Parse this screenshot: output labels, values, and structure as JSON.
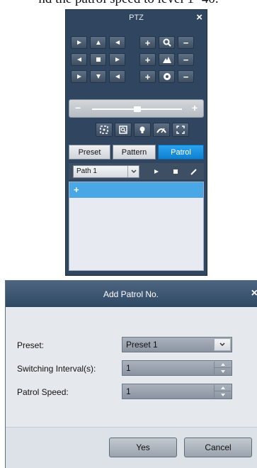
{
  "caption": {
    "cropped_text": "nd the patrol speed to level 1- 40."
  },
  "ptz": {
    "title": "PTZ",
    "close_glyph": "×",
    "direction_grid": [
      "up-left",
      "up",
      "up-right",
      "left",
      "stop-auto",
      "right",
      "down-left",
      "down",
      "down-right"
    ],
    "lens_controls": [
      {
        "name": "zoom",
        "plus": "+",
        "minus": "−"
      },
      {
        "name": "focus",
        "plus": "+",
        "minus": "−"
      },
      {
        "name": "iris",
        "plus": "+",
        "minus": "−"
      }
    ],
    "speed_slider": {
      "minus": "−",
      "plus": "+",
      "level": 0.5
    },
    "tools": [
      "3d-zoom-icon",
      "area-focus-icon",
      "light-icon",
      "wiper-icon",
      "menu-icon"
    ],
    "tabs": [
      {
        "label": "Preset",
        "active": false
      },
      {
        "label": "Pattern",
        "active": false
      },
      {
        "label": "Patrol",
        "active": true
      }
    ],
    "path_select": "Path 1",
    "add_row": "+"
  },
  "dialog": {
    "title": "Add Patrol No.",
    "close_glyph": "×",
    "preset_label": "Preset:",
    "preset_value": "Preset 1",
    "interval_label": "Switching Interval(s):",
    "interval_value": "1",
    "speed_label": "Patrol Speed:",
    "speed_value": "1",
    "yes_label": "Yes",
    "cancel_label": "Cancel"
  },
  "colors": {
    "ptz_bg": "#2f4560",
    "active_tab": "#1a8fe0",
    "list_highlight": "#4aa7e5",
    "dialog_bg": "#e5e9ee"
  }
}
